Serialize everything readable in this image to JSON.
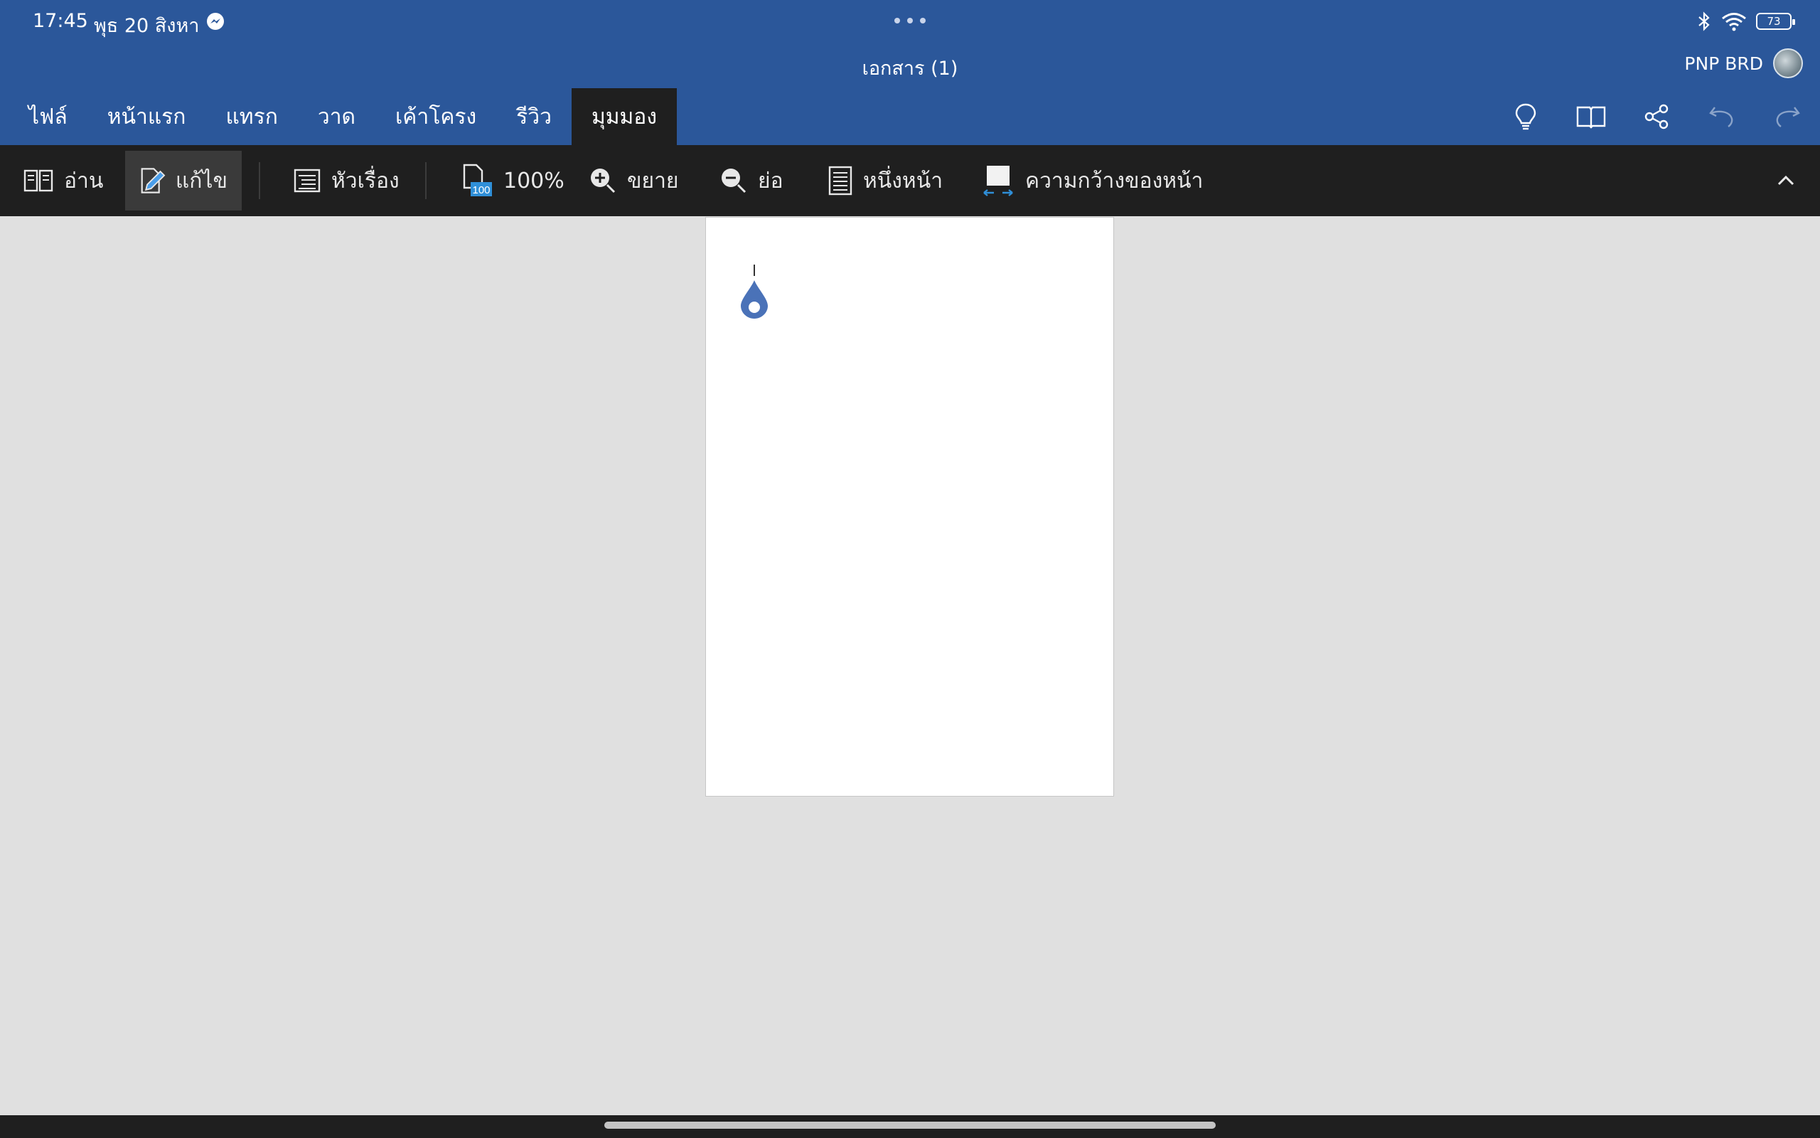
{
  "status_bar": {
    "time": "17:45",
    "date": "พุธ 20 สิงหา",
    "battery": "73"
  },
  "title_bar": {
    "document_title": "เอกสาร (1)",
    "account_name": "PNP BRD"
  },
  "ribbon": {
    "tabs": [
      {
        "label": "ไฟล์",
        "active": false
      },
      {
        "label": "หน้าแรก",
        "active": false
      },
      {
        "label": "แทรก",
        "active": false
      },
      {
        "label": "วาด",
        "active": false
      },
      {
        "label": "เค้าโครง",
        "active": false
      },
      {
        "label": "รีวิว",
        "active": false
      },
      {
        "label": "มุมมอง",
        "active": true
      }
    ],
    "right_icons": [
      "lightbulb-icon",
      "book-icon",
      "share-icon",
      "undo-icon",
      "redo-icon"
    ]
  },
  "toolbar": {
    "read": "อ่าน",
    "edit": "แก้ไข",
    "headings": "หัวเรื่อง",
    "zoom_100": "100%",
    "zoom_badge": "100",
    "zoom_in": "ขยาย",
    "zoom_out": "ย่อ",
    "one_page": "หนึ่งหน้า",
    "page_width": "ความกว้างของหน้า"
  },
  "colors": {
    "title_blue": "#2b579a",
    "toolbar_dark": "#1f1f1f",
    "canvas": "#e0e0e0",
    "handle_blue": "#4a72b8"
  }
}
